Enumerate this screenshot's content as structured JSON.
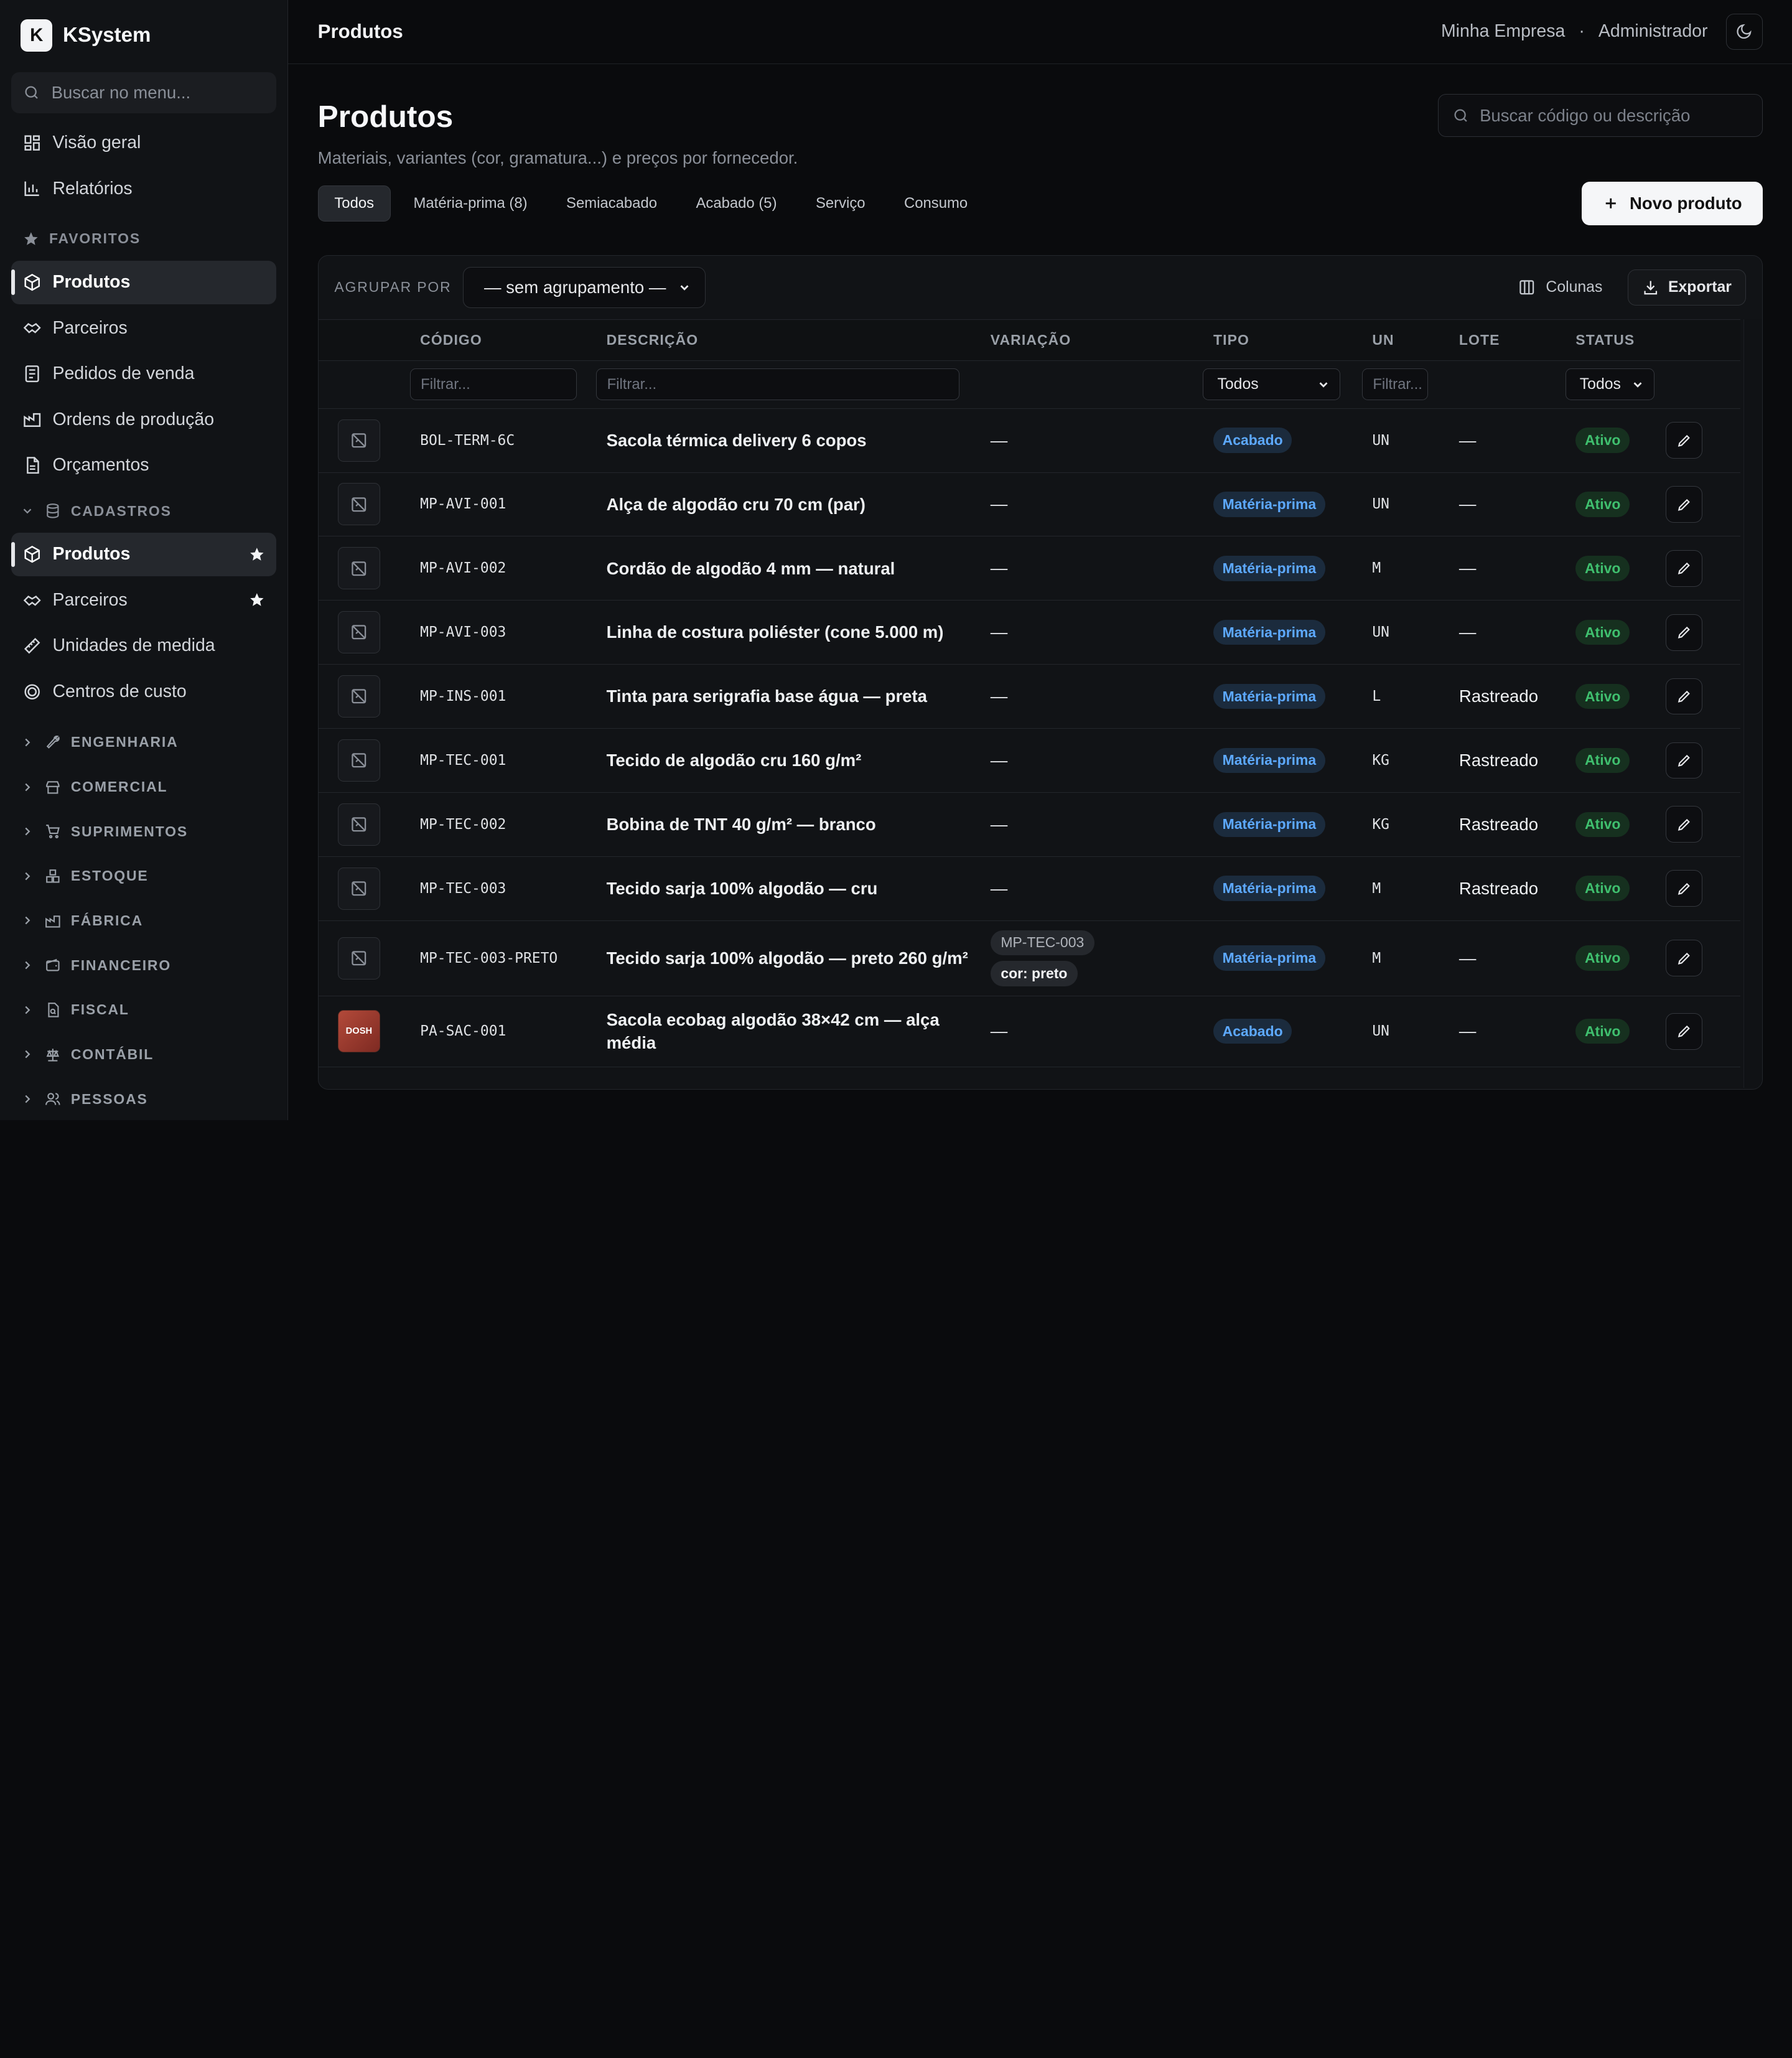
{
  "brand": {
    "logo_letter": "K",
    "name": "KSystem"
  },
  "sidebar": {
    "search_placeholder": "Buscar no menu...",
    "top_items": [
      {
        "label": "Visão geral",
        "icon": "dashboard-icon"
      },
      {
        "label": "Relatórios",
        "icon": "bar-chart-icon"
      }
    ],
    "favorites_header": "FAVORITOS",
    "favorites": [
      {
        "label": "Produtos",
        "icon": "package-icon",
        "active": true
      },
      {
        "label": "Parceiros",
        "icon": "handshake-icon"
      },
      {
        "label": "Pedidos de venda",
        "icon": "receipt-icon"
      },
      {
        "label": "Ordens de produção",
        "icon": "factory-icon"
      },
      {
        "label": "Orçamentos",
        "icon": "document-icon"
      }
    ],
    "cadastros_header": "CADASTROS",
    "cadastros": [
      {
        "label": "Produtos",
        "icon": "package-icon",
        "active": true,
        "starred": true
      },
      {
        "label": "Parceiros",
        "icon": "handshake-icon",
        "starred": true
      },
      {
        "label": "Unidades de medida",
        "icon": "ruler-icon"
      },
      {
        "label": "Centros de custo",
        "icon": "target-icon"
      }
    ],
    "sections": [
      "ENGENHARIA",
      "COMERCIAL",
      "SUPRIMENTOS",
      "ESTOQUE",
      "FÁBRICA",
      "FINANCEIRO",
      "FISCAL",
      "CONTÁBIL",
      "PESSOAS"
    ]
  },
  "topbar": {
    "title": "Produtos",
    "company": "Minha Empresa",
    "separator": "·",
    "user": "Administrador"
  },
  "page": {
    "title": "Produtos",
    "subtitle": "Materiais, variantes (cor, gramatura...) e preços por fornecedor.",
    "search_placeholder": "Buscar código ou descrição",
    "new_button": "Novo produto",
    "tabs": [
      {
        "label": "Todos",
        "active": true
      },
      {
        "label": "Matéria-prima (8)"
      },
      {
        "label": "Semiacabado"
      },
      {
        "label": "Acabado (5)"
      },
      {
        "label": "Serviço"
      },
      {
        "label": "Consumo"
      }
    ]
  },
  "toolbar": {
    "group_label": "AGRUPAR POR",
    "group_value": "— sem agrupamento —",
    "columns": "Colunas",
    "export": "Exportar"
  },
  "table": {
    "headers": {
      "code": "CÓDIGO",
      "desc": "DESCRIÇÃO",
      "variation": "VARIAÇÃO",
      "type": "TIPO",
      "unit": "UN",
      "lot": "LOTE",
      "status": "STATUS"
    },
    "filters": {
      "code": "Filtrar...",
      "desc": "Filtrar...",
      "type": "Todos",
      "unit": "Filtrar...",
      "status": "Todos"
    },
    "rows": [
      {
        "code": "BOL-TERM-6C",
        "desc": "Sacola térmica delivery 6 copos",
        "variation": "—",
        "type": "Acabado",
        "unit": "UN",
        "lot": "—",
        "status": "Ativo"
      },
      {
        "code": "MP-AVI-001",
        "desc": "Alça de algodão cru 70 cm (par)",
        "variation": "—",
        "type": "Matéria-prima",
        "unit": "UN",
        "lot": "—",
        "status": "Ativo"
      },
      {
        "code": "MP-AVI-002",
        "desc": "Cordão de algodão 4 mm — natural",
        "variation": "—",
        "type": "Matéria-prima",
        "unit": "M",
        "lot": "—",
        "status": "Ativo"
      },
      {
        "code": "MP-AVI-003",
        "desc": "Linha de costura poliéster (cone 5.000 m)",
        "variation": "—",
        "type": "Matéria-prima",
        "unit": "UN",
        "lot": "—",
        "status": "Ativo"
      },
      {
        "code": "MP-INS-001",
        "desc": "Tinta para serigrafia base água — preta",
        "variation": "—",
        "type": "Matéria-prima",
        "unit": "L",
        "lot": "Rastreado",
        "status": "Ativo"
      },
      {
        "code": "MP-TEC-001",
        "desc": "Tecido de algodão cru 160 g/m²",
        "variation": "—",
        "type": "Matéria-prima",
        "unit": "KG",
        "lot": "Rastreado",
        "status": "Ativo"
      },
      {
        "code": "MP-TEC-002",
        "desc": "Bobina de TNT 40 g/m² — branco",
        "variation": "—",
        "type": "Matéria-prima",
        "unit": "KG",
        "lot": "Rastreado",
        "status": "Ativo"
      },
      {
        "code": "MP-TEC-003",
        "desc": "Tecido sarja 100% algodão — cru",
        "variation": "—",
        "type": "Matéria-prima",
        "unit": "M",
        "lot": "Rastreado",
        "status": "Ativo"
      },
      {
        "code": "MP-TEC-003-PRETO",
        "desc": "Tecido sarja 100% algodão — preto 260 g/m²",
        "variation_parent": "MP-TEC-003",
        "variation_attr": "cor: preto",
        "type": "Matéria-prima",
        "unit": "M",
        "lot": "—",
        "status": "Ativo"
      },
      {
        "code": "PA-SAC-001",
        "desc": "Sacola ecobag algodão 38×42 cm — alça média",
        "variation": "—",
        "type": "Acabado",
        "unit": "UN",
        "lot": "—",
        "status": "Ativo",
        "thumb_text": "DOSH"
      }
    ]
  },
  "colors": {
    "accent_blue": "#5da9ff",
    "status_green": "#3fbf6e",
    "background": "#0a0b0d"
  }
}
